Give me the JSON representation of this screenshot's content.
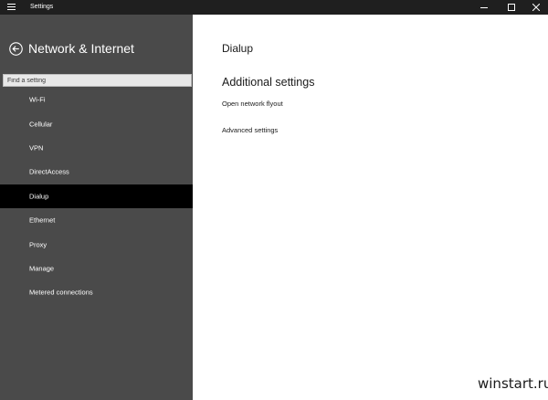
{
  "titlebar": {
    "title": "Settings"
  },
  "sidebar": {
    "title": "Network & Internet",
    "search_placeholder": "Find a setting",
    "items": [
      {
        "label": "Wi-Fi"
      },
      {
        "label": "Cellular"
      },
      {
        "label": "VPN"
      },
      {
        "label": "DirectAccess"
      },
      {
        "label": "Dialup"
      },
      {
        "label": "Ethernet"
      },
      {
        "label": "Proxy"
      },
      {
        "label": "Manage"
      },
      {
        "label": "Metered connections"
      }
    ],
    "selected": "Dialup"
  },
  "main": {
    "page_title": "Dialup",
    "section_title": "Additional settings",
    "links": [
      {
        "label": "Open network flyout"
      },
      {
        "label": "Advanced settings"
      }
    ]
  },
  "watermark": "winstart.ru",
  "colors": {
    "titlebar_bg": "#1f1f1f",
    "sidebar_bg": "#4a4a4a",
    "selected_bg": "#000000",
    "main_bg": "#ffffff"
  }
}
